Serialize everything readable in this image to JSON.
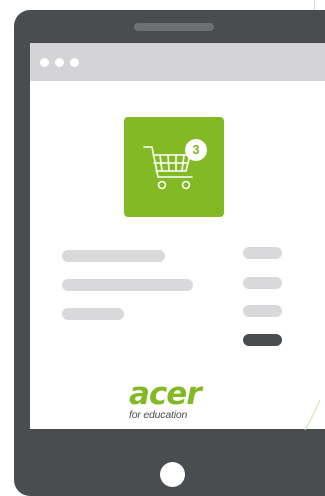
{
  "cart": {
    "count": "3",
    "icon": "shopping-cart-icon"
  },
  "brand": {
    "name": "acer",
    "tagline": "for education"
  },
  "colors": {
    "accent_green": "#83b925",
    "device_body": "#4a4d50",
    "browser_bar": "#d4d4d6",
    "placeholder_bar": "#d9d9db",
    "active_bar": "#4a4d50"
  }
}
